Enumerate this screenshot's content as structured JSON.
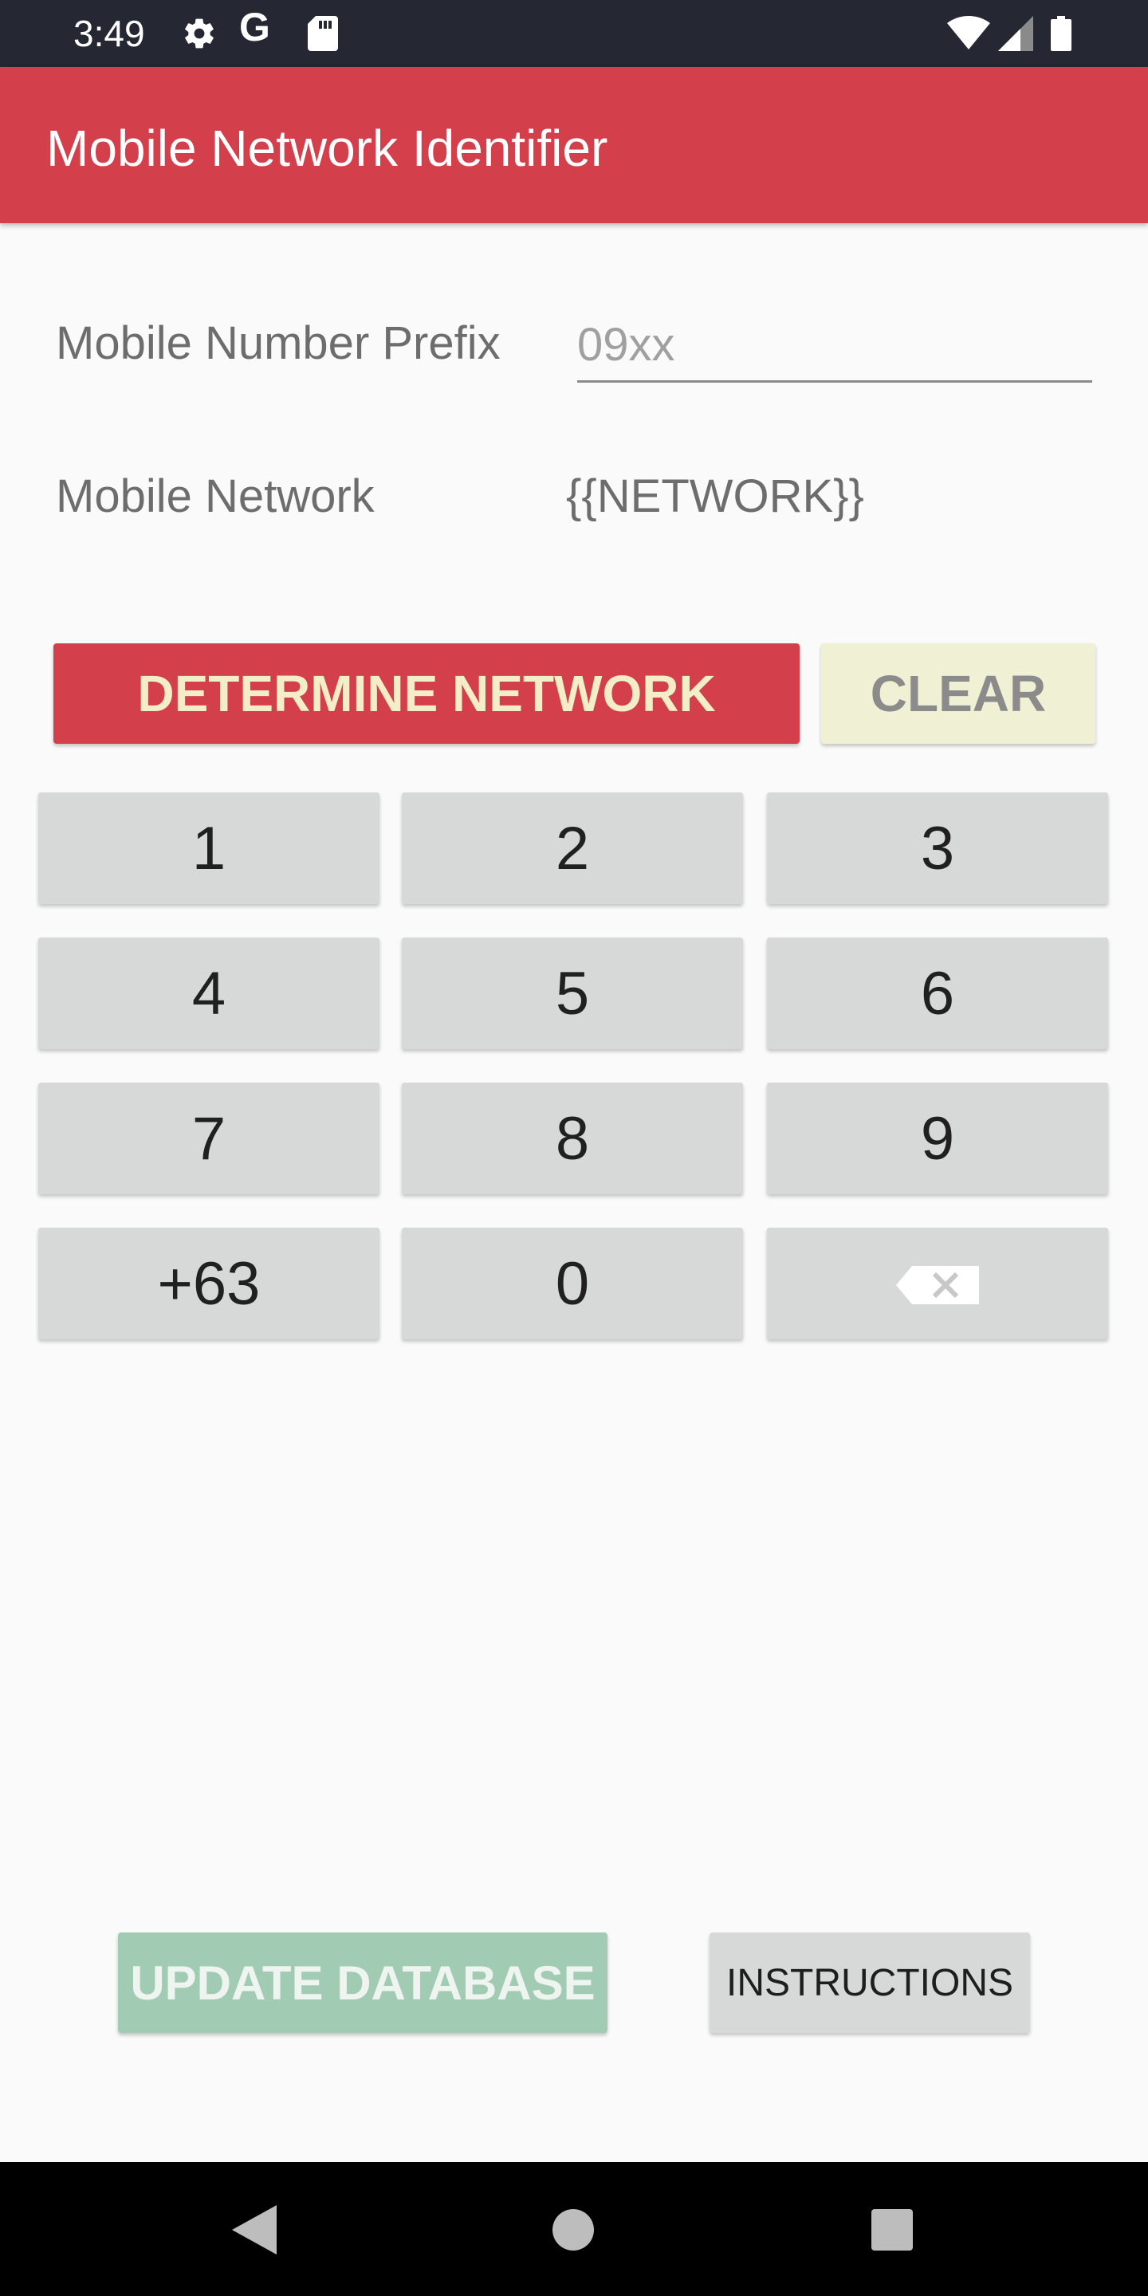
{
  "status_bar": {
    "time": "3:49",
    "icons": [
      "gear-icon",
      "google-g-icon",
      "sd-card-icon",
      "wifi-icon",
      "cell-signal-icon",
      "battery-icon"
    ],
    "g_letter": "G"
  },
  "app_bar": {
    "title": "Mobile Network Identifier",
    "color": "#d33f4b"
  },
  "form": {
    "prefix_label": "Mobile Number Prefix",
    "prefix_value": "",
    "prefix_placeholder": "09xx",
    "network_label": "Mobile Network",
    "network_value": "{{NETWORK}}"
  },
  "actions": {
    "determine_label": "DETERMINE NETWORK",
    "clear_label": "CLEAR"
  },
  "keypad": {
    "keys": [
      "1",
      "2",
      "3",
      "4",
      "5",
      "6",
      "7",
      "8",
      "9",
      "+63",
      "0"
    ],
    "backspace_icon": "backspace-icon"
  },
  "footer": {
    "update_label": "UPDATE DATABASE",
    "instructions_label": "INSTRUCTIONS"
  },
  "nav_bar": {
    "icons": [
      "back-icon",
      "home-icon",
      "recents-icon"
    ]
  },
  "colors": {
    "accent": "#d33f4b",
    "status_bar": "#252833",
    "clear_bg": "#f0f0d4",
    "update_bg": "#a2cbb4",
    "key_bg": "#d7d8d8"
  }
}
